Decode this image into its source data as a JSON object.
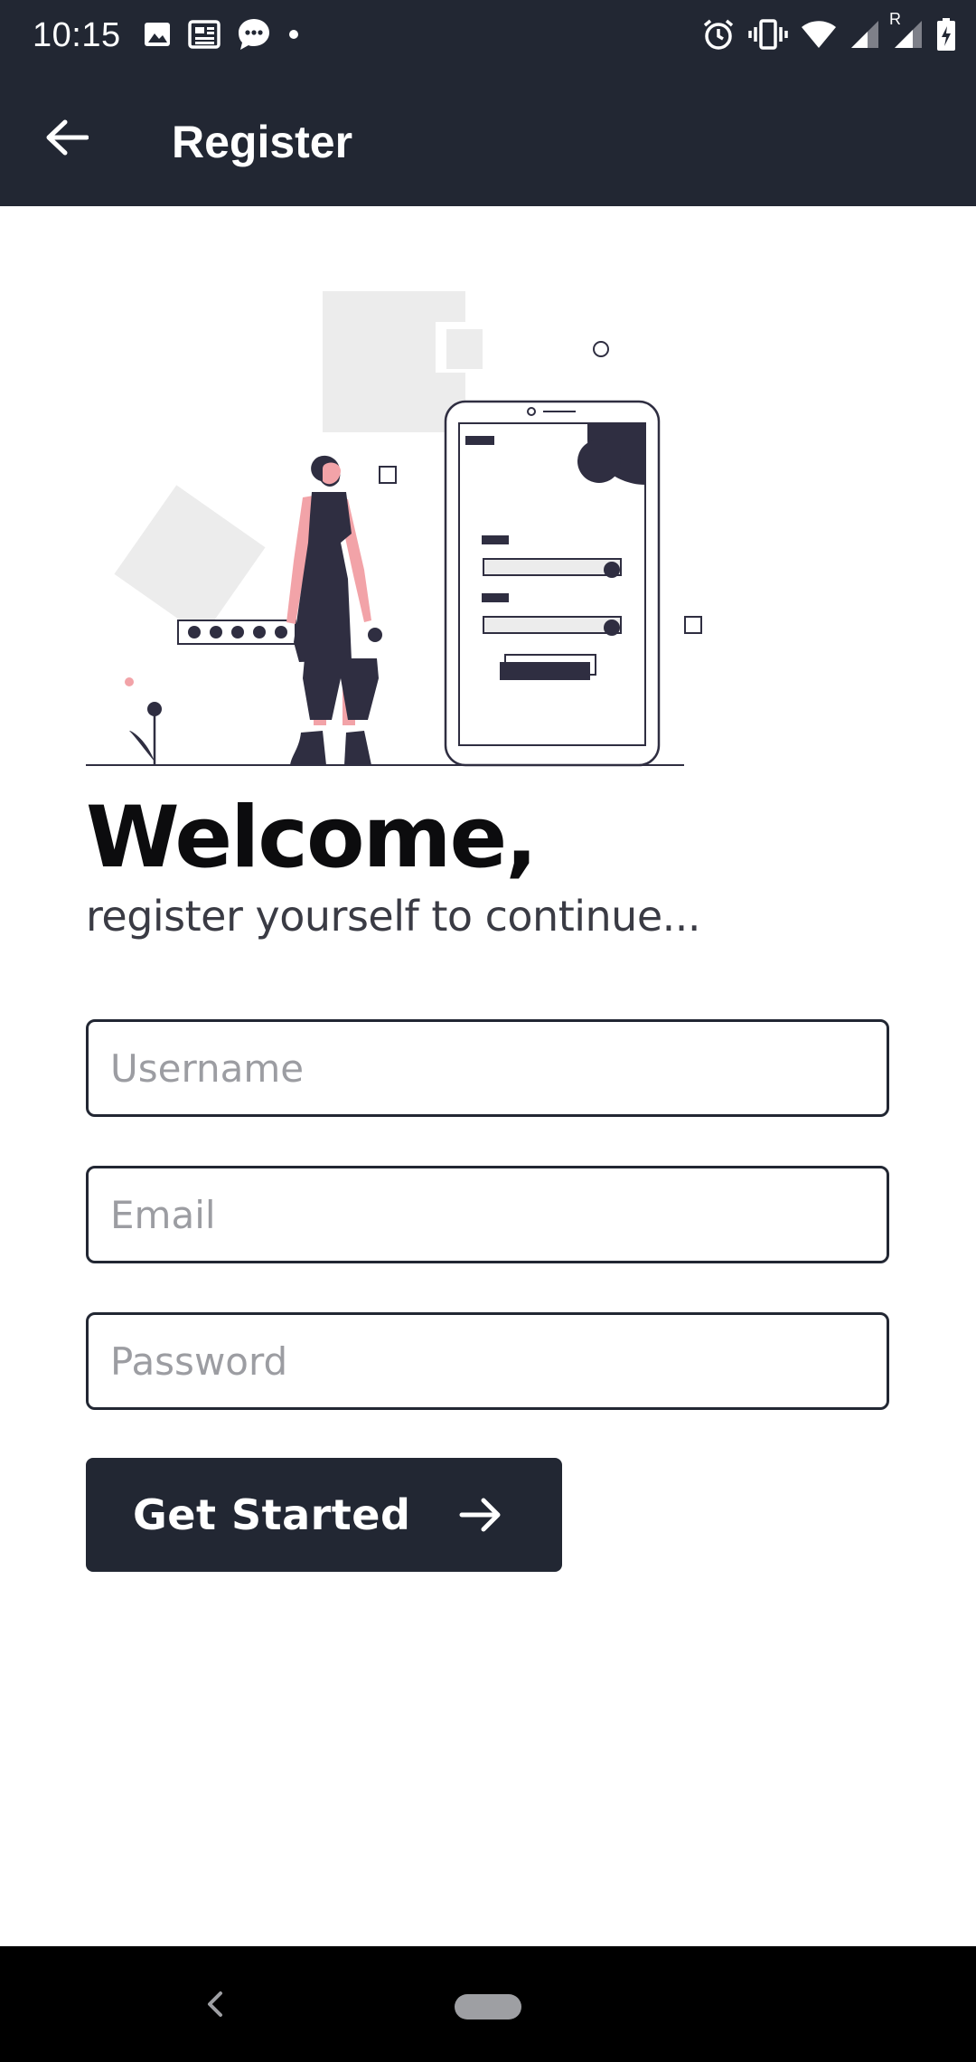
{
  "status_bar": {
    "time": "10:15",
    "left_icons": [
      "image-icon",
      "news-icon",
      "message-icon",
      "dot-icon"
    ],
    "right_icons": [
      "alarm-icon",
      "vibrate-icon",
      "wifi-icon",
      "signal-icon",
      "signal-roaming-icon",
      "battery-charging-icon"
    ],
    "roaming_label": "R"
  },
  "app_bar": {
    "title": "Register",
    "back_icon": "arrow-left-icon"
  },
  "hero": {
    "illustration": "woman-standing-next-to-phone-login-illustration"
  },
  "welcome": {
    "title": "Welcome,",
    "subtitle": "register yourself to continue..."
  },
  "form": {
    "username_placeholder": "Username",
    "email_placeholder": "Email",
    "password_placeholder": "Password",
    "submit_label": "Get Started",
    "submit_icon": "arrow-right-icon"
  },
  "nav_bar": {
    "back_icon": "chevron-left-icon",
    "home_icon": "home-pill-icon"
  },
  "colors": {
    "primary": "#222733",
    "illustration_accent": "#f2a3a8",
    "illustration_dark": "#2f2e41",
    "placeholder": "#9c9da2",
    "light_gray": "#ececec"
  }
}
